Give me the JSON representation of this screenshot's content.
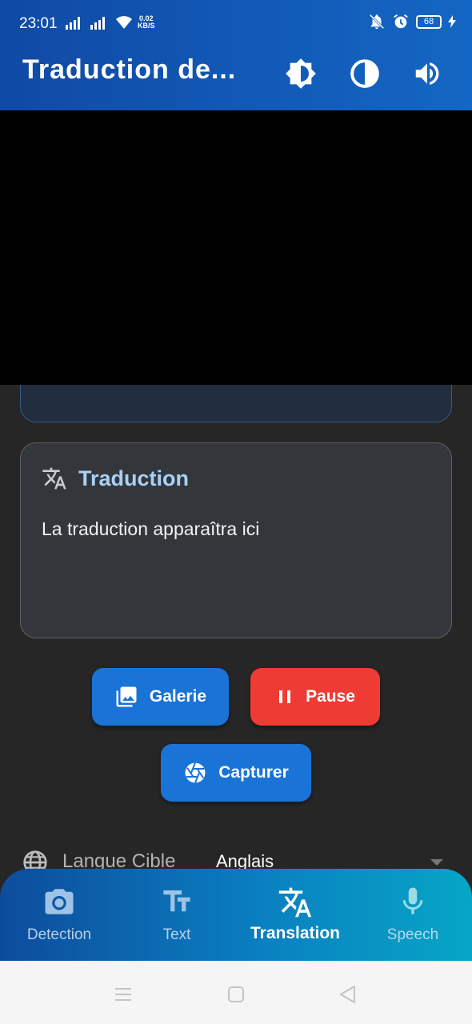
{
  "status_bar": {
    "time": "23:01",
    "net_speed_value": "0.02",
    "net_speed_unit": "KB/S",
    "battery": "68"
  },
  "app_bar": {
    "title": "Traduction de...",
    "actions": [
      "brightness-icon",
      "contrast-icon",
      "volume-icon"
    ]
  },
  "translation_card": {
    "icon": "translate-icon",
    "title": "Traduction",
    "placeholder_text": "La traduction apparaîtra ici"
  },
  "buttons": {
    "gallery": "Galerie",
    "pause": "Pause",
    "capture": "Capturer"
  },
  "language": {
    "label": "Langue Cible",
    "value": "Anglais"
  },
  "bottom_nav": {
    "items": [
      {
        "label": "Detection",
        "icon": "camera-icon"
      },
      {
        "label": "Text",
        "icon": "text-fields-icon"
      },
      {
        "label": "Translation",
        "icon": "translate-icon",
        "active": true
      },
      {
        "label": "Speech",
        "icon": "mic-icon"
      }
    ]
  },
  "colors": {
    "accent": "#1a73d6",
    "danger": "#ee3b33",
    "card_title": "#a9d1f7"
  }
}
